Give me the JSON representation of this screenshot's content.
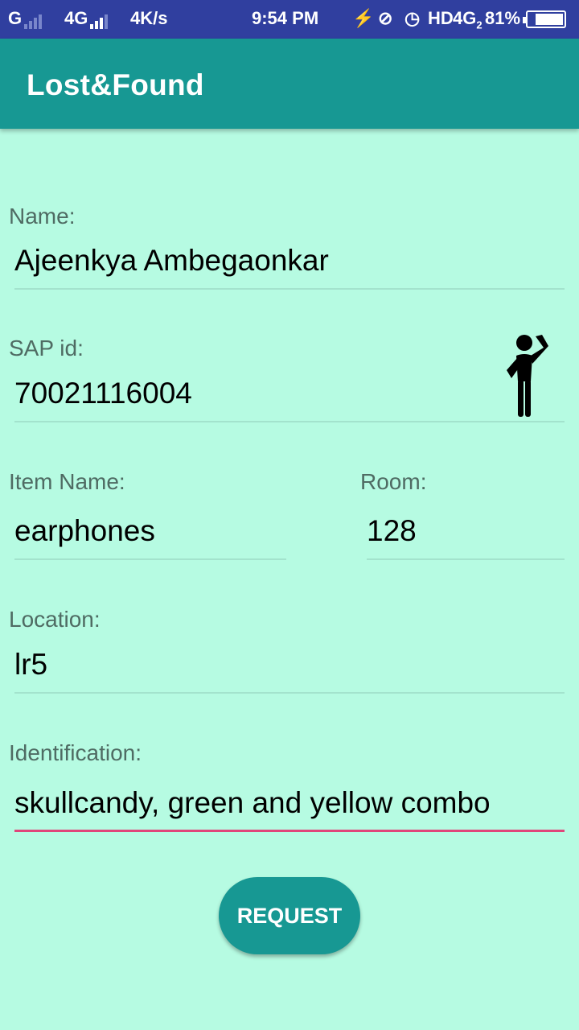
{
  "status_bar": {
    "net1": "G",
    "net2": "4G",
    "speed": "4K/s",
    "time": "9:54 PM",
    "hd": "HD",
    "net3": "4G",
    "net3_sub": "2",
    "battery_text": "81%",
    "battery_level": 0.81
  },
  "app_bar": {
    "title": "Lost&Found",
    "color": "#179893"
  },
  "form": {
    "name": {
      "label": "Name:",
      "value": "Ajeenkya Ambegaonkar"
    },
    "sap_id": {
      "label": "SAP id:",
      "value": "70021116004"
    },
    "item_name": {
      "label": "Item Name:",
      "value": "earphones"
    },
    "room": {
      "label": "Room:",
      "value": "128"
    },
    "location": {
      "label": "Location:",
      "value": "lr5"
    },
    "identification": {
      "label": "Identification:",
      "value": "skullcandy, green and yellow combo"
    },
    "icon": "person-thinking-icon"
  },
  "actions": {
    "request_label": "REQUEST"
  },
  "colors": {
    "background": "#b6fbe2",
    "accent": "#179893",
    "status_bar": "#303f9f",
    "focus_underline": "#e0457a"
  }
}
